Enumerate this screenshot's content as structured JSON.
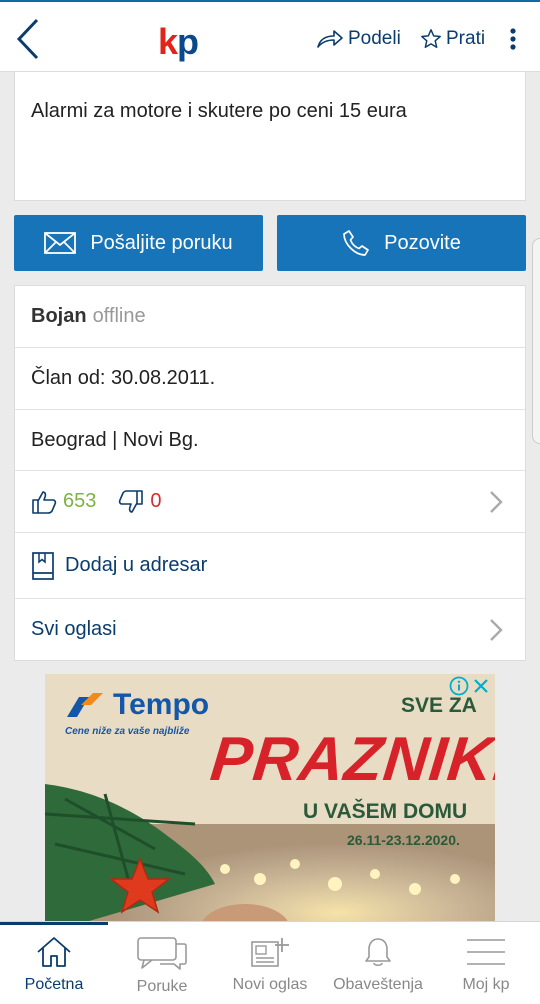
{
  "header": {
    "logo_k": "k",
    "logo_p": "p",
    "share_label": "Podeli",
    "follow_label": "Prati"
  },
  "listing": {
    "title": "Alarmi za motore i skutere po ceni 15 eura"
  },
  "actions": {
    "message_label": "Pošaljite poruku",
    "call_label": "Pozovite"
  },
  "seller": {
    "name": "Bojan",
    "status": "offline",
    "member_since": "Član od: 30.08.2011.",
    "location": "Beograd | Novi Bg.",
    "positive": "653",
    "negative": "0",
    "add_contact_label": "Dodaj u adresar",
    "all_ads_label": "Svi oglasi"
  },
  "ad": {
    "brand": "Tempo",
    "tagline": "Cene niže za vaše najbliže",
    "headline_small": "SVE ZA",
    "headline": "PRAZNIKE",
    "subline": "U VAŠEM DOMU",
    "dates": "26.11-23.12.2020."
  },
  "bottom_nav": {
    "items": [
      {
        "label": "Početna",
        "icon": "home-icon",
        "active": true
      },
      {
        "label": "Poruke",
        "icon": "chat-icon",
        "active": false
      },
      {
        "label": "Novi oglas",
        "icon": "new-ad-icon",
        "active": false
      },
      {
        "label": "Obaveštenja",
        "icon": "bell-icon",
        "active": false
      },
      {
        "label": "Moj kp",
        "icon": "menu-icon",
        "active": false
      }
    ]
  },
  "colors": {
    "primary_blue": "#1774b8",
    "dark_blue": "#0a3c6e",
    "positive_green": "#7cb342",
    "negative_red": "#d32f2f",
    "logo_red": "#e2231a"
  }
}
